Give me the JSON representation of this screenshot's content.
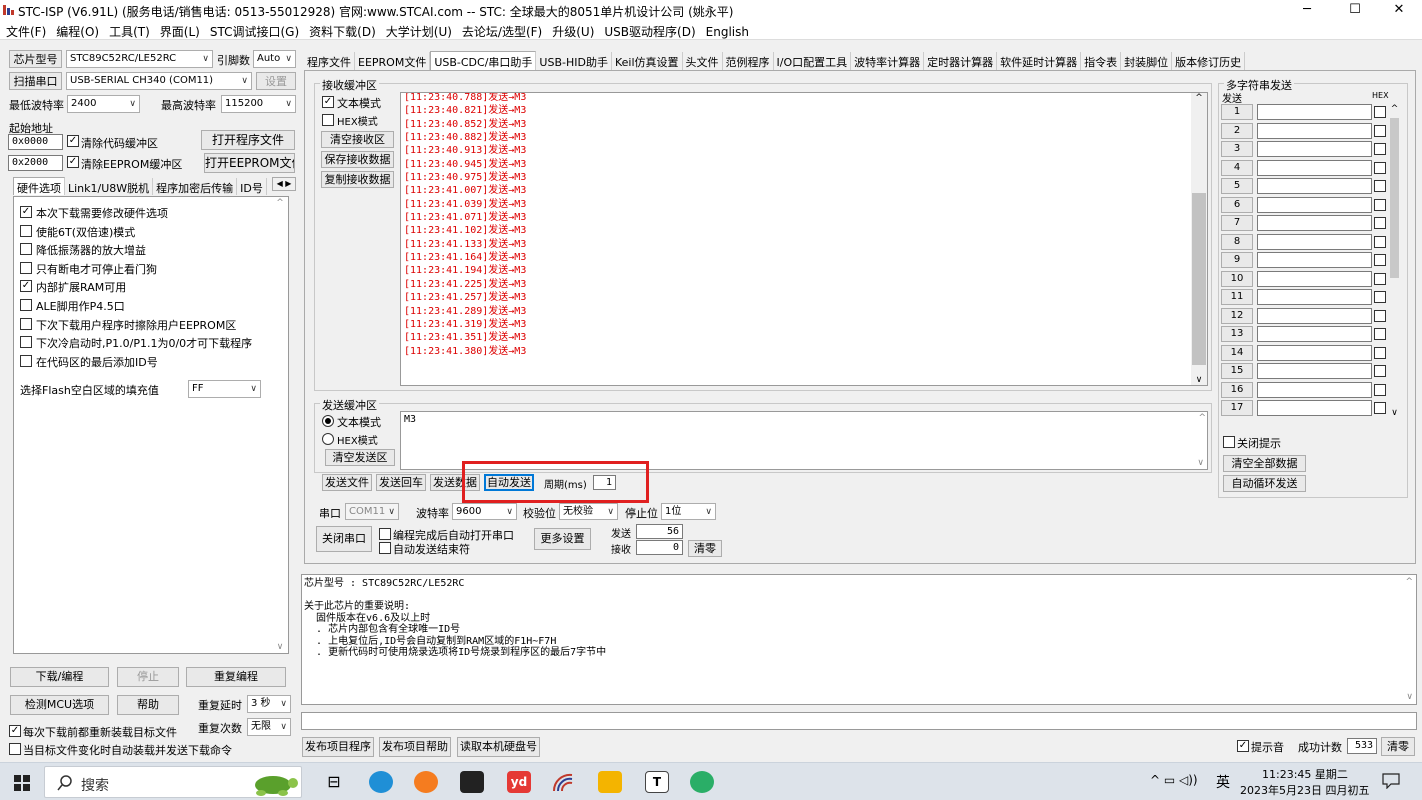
{
  "window": {
    "title": "STC-ISP (V6.91L) (服务电话/销售电话: 0513-55012928) 官网:www.STCAI.com  -- STC: 全球最大的8051单片机设计公司 (姚永平)",
    "min": "─",
    "max": "☐",
    "close": "✕"
  },
  "menu": [
    "文件(F)",
    "编程(O)",
    "工具(T)",
    "界面(L)",
    "STC调试接口(G)",
    "资料下载(D)",
    "大学计划(U)",
    "去论坛/选型(F)",
    "升级(U)",
    "USB驱动程序(D)",
    "English"
  ],
  "left": {
    "chip_btn": "芯片型号",
    "chip_value": "STC89C52RC/LE52RC",
    "pin_label": "引脚数",
    "pin_value": "Auto",
    "scan_btn": "扫描串口",
    "port_value": "USB-SERIAL CH340 (COM11)",
    "setting_btn": "设置",
    "min_baud_label": "最低波特率",
    "min_baud": "2400",
    "max_baud_label": "最高波特率",
    "max_baud": "115200",
    "start_addr_label": "起始地址",
    "addr1": "0x0000",
    "clear_code": "清除代码缓冲区",
    "open_prog": "打开程序文件",
    "addr2": "0x2000",
    "clear_eeprom": "清除EEPROM缓冲区",
    "open_eeprom": "打开EEPROM文件",
    "tabs": [
      "硬件选项",
      "Link1/U8W脱机",
      "程序加密后传输",
      "ID号"
    ],
    "options": [
      {
        "label": "本次下载需要修改硬件选项",
        "checked": true
      },
      {
        "label": "使能6T(双倍速)模式",
        "checked": false
      },
      {
        "label": "降低振荡器的放大增益",
        "checked": false
      },
      {
        "label": "只有断电才可停止看门狗",
        "checked": false
      },
      {
        "label": "内部扩展RAM可用",
        "checked": true
      },
      {
        "label": "ALE脚用作P4.5口",
        "checked": false
      },
      {
        "label": "下次下载用户程序时擦除用户EEPROM区",
        "checked": false
      },
      {
        "label": "下次冷启动时,P1.0/P1.1为0/0才可下载程序",
        "checked": false
      },
      {
        "label": "在代码区的最后添加ID号",
        "checked": false
      }
    ],
    "fill_label": "选择Flash空白区域的填充值",
    "fill_value": "FF",
    "download_btn": "下载/编程",
    "stop_btn": "停止",
    "reprog_btn": "重复编程",
    "detect_btn": "检测MCU选项",
    "help_btn": "帮助",
    "delay_label": "重复延时",
    "delay_value": "3 秒",
    "reload_label": "每次下载前都重新装载目标文件",
    "count_label": "重复次数",
    "count_value": "无限",
    "auto_label": "当目标文件变化时自动装载并发送下载命令"
  },
  "tabs": [
    "程序文件",
    "EEPROM文件",
    "USB-CDC/串口助手",
    "USB-HID助手",
    "Keil仿真设置",
    "头文件",
    "范例程序",
    "I/O口配置工具",
    "波特率计算器",
    "定时器计算器",
    "软件延时计算器",
    "指令表",
    "封装脚位",
    "版本修订历史"
  ],
  "recv": {
    "title": "接收缓冲区",
    "text_mode": "文本模式",
    "hex_mode": "HEX模式",
    "clear": "清空接收区",
    "save": "保存接收数据",
    "copy": "复制接收数据",
    "lines": [
      "[11:23:40.788]发送→M3",
      "[11:23:40.821]发送→M3",
      "[11:23:40.852]发送→M3",
      "[11:23:40.882]发送→M3",
      "[11:23:40.913]发送→M3",
      "[11:23:40.945]发送→M3",
      "[11:23:40.975]发送→M3",
      "[11:23:41.007]发送→M3",
      "[11:23:41.039]发送→M3",
      "[11:23:41.071]发送→M3",
      "[11:23:41.102]发送→M3",
      "[11:23:41.133]发送→M3",
      "[11:23:41.164]发送→M3",
      "[11:23:41.194]发送→M3",
      "[11:23:41.225]发送→M3",
      "[11:23:41.257]发送→M3",
      "[11:23:41.289]发送→M3",
      "[11:23:41.319]发送→M3",
      "[11:23:41.351]发送→M3",
      "[11:23:41.380]发送→M3"
    ]
  },
  "send": {
    "title": "发送缓冲区",
    "text_mode": "文本模式",
    "hex_mode": "HEX模式",
    "clear": "清空发送区",
    "content": "M3",
    "send_file": "发送文件",
    "send_cr": "发送回车",
    "send_data": "发送数据",
    "auto_send": "自动发送",
    "period_label": "周期(ms)",
    "period_value": "1"
  },
  "serial": {
    "port_label": "串口",
    "port_value": "COM11",
    "baud_label": "波特率",
    "baud_value": "9600",
    "parity_label": "校验位",
    "parity_value": "无校验",
    "stop_label": "停止位",
    "stop_value": "1位",
    "close_btn": "关闭串口",
    "auto_open": "编程完成后自动打开串口",
    "auto_end": "自动发送结束符",
    "more_btn": "更多设置",
    "sent_label": "发送",
    "sent_value": "56",
    "recv_label": "接收",
    "recv_value": "0",
    "clear_btn": "清零"
  },
  "multi": {
    "title": "多字符串发送",
    "send_col": "发送",
    "hex_col": "HEX",
    "rows": [
      "1",
      "2",
      "3",
      "4",
      "5",
      "6",
      "7",
      "8",
      "9",
      "10",
      "11",
      "12",
      "13",
      "14",
      "15",
      "16",
      "17"
    ],
    "close_tip": "关闭提示",
    "clear_all": "清空全部数据",
    "auto_loop": "自动循环发送"
  },
  "info": {
    "lines": [
      "芯片型号 : STC89C52RC/LE52RC",
      "",
      "关于此芯片的重要说明:",
      "  固件版本在v6.6及以上时",
      "  . 芯片内部包含有全球唯一ID号",
      "  . 上电复位后,ID号会自动复制到RAM区域的F1H~F7H",
      "  . 更新代码时可使用烧录选项将ID号烧录到程序区的最后7字节中"
    ]
  },
  "bottom": {
    "publish": "发布项目程序",
    "publish_help": "发布项目帮助",
    "read_disk": "读取本机硬盘号",
    "beep": "提示音",
    "success_label": "成功计数",
    "success_value": "533",
    "clear": "清零"
  },
  "taskbar": {
    "search": "搜索",
    "ime": "英",
    "time": "11:23:45 星期二",
    "date": "2023年5月23日 四月初五",
    "tray": "^ ▭ ◁))"
  },
  "colors": {
    "highlight_box": "#e02020",
    "log_text": "#dd0000",
    "focus": "#0078d7"
  }
}
